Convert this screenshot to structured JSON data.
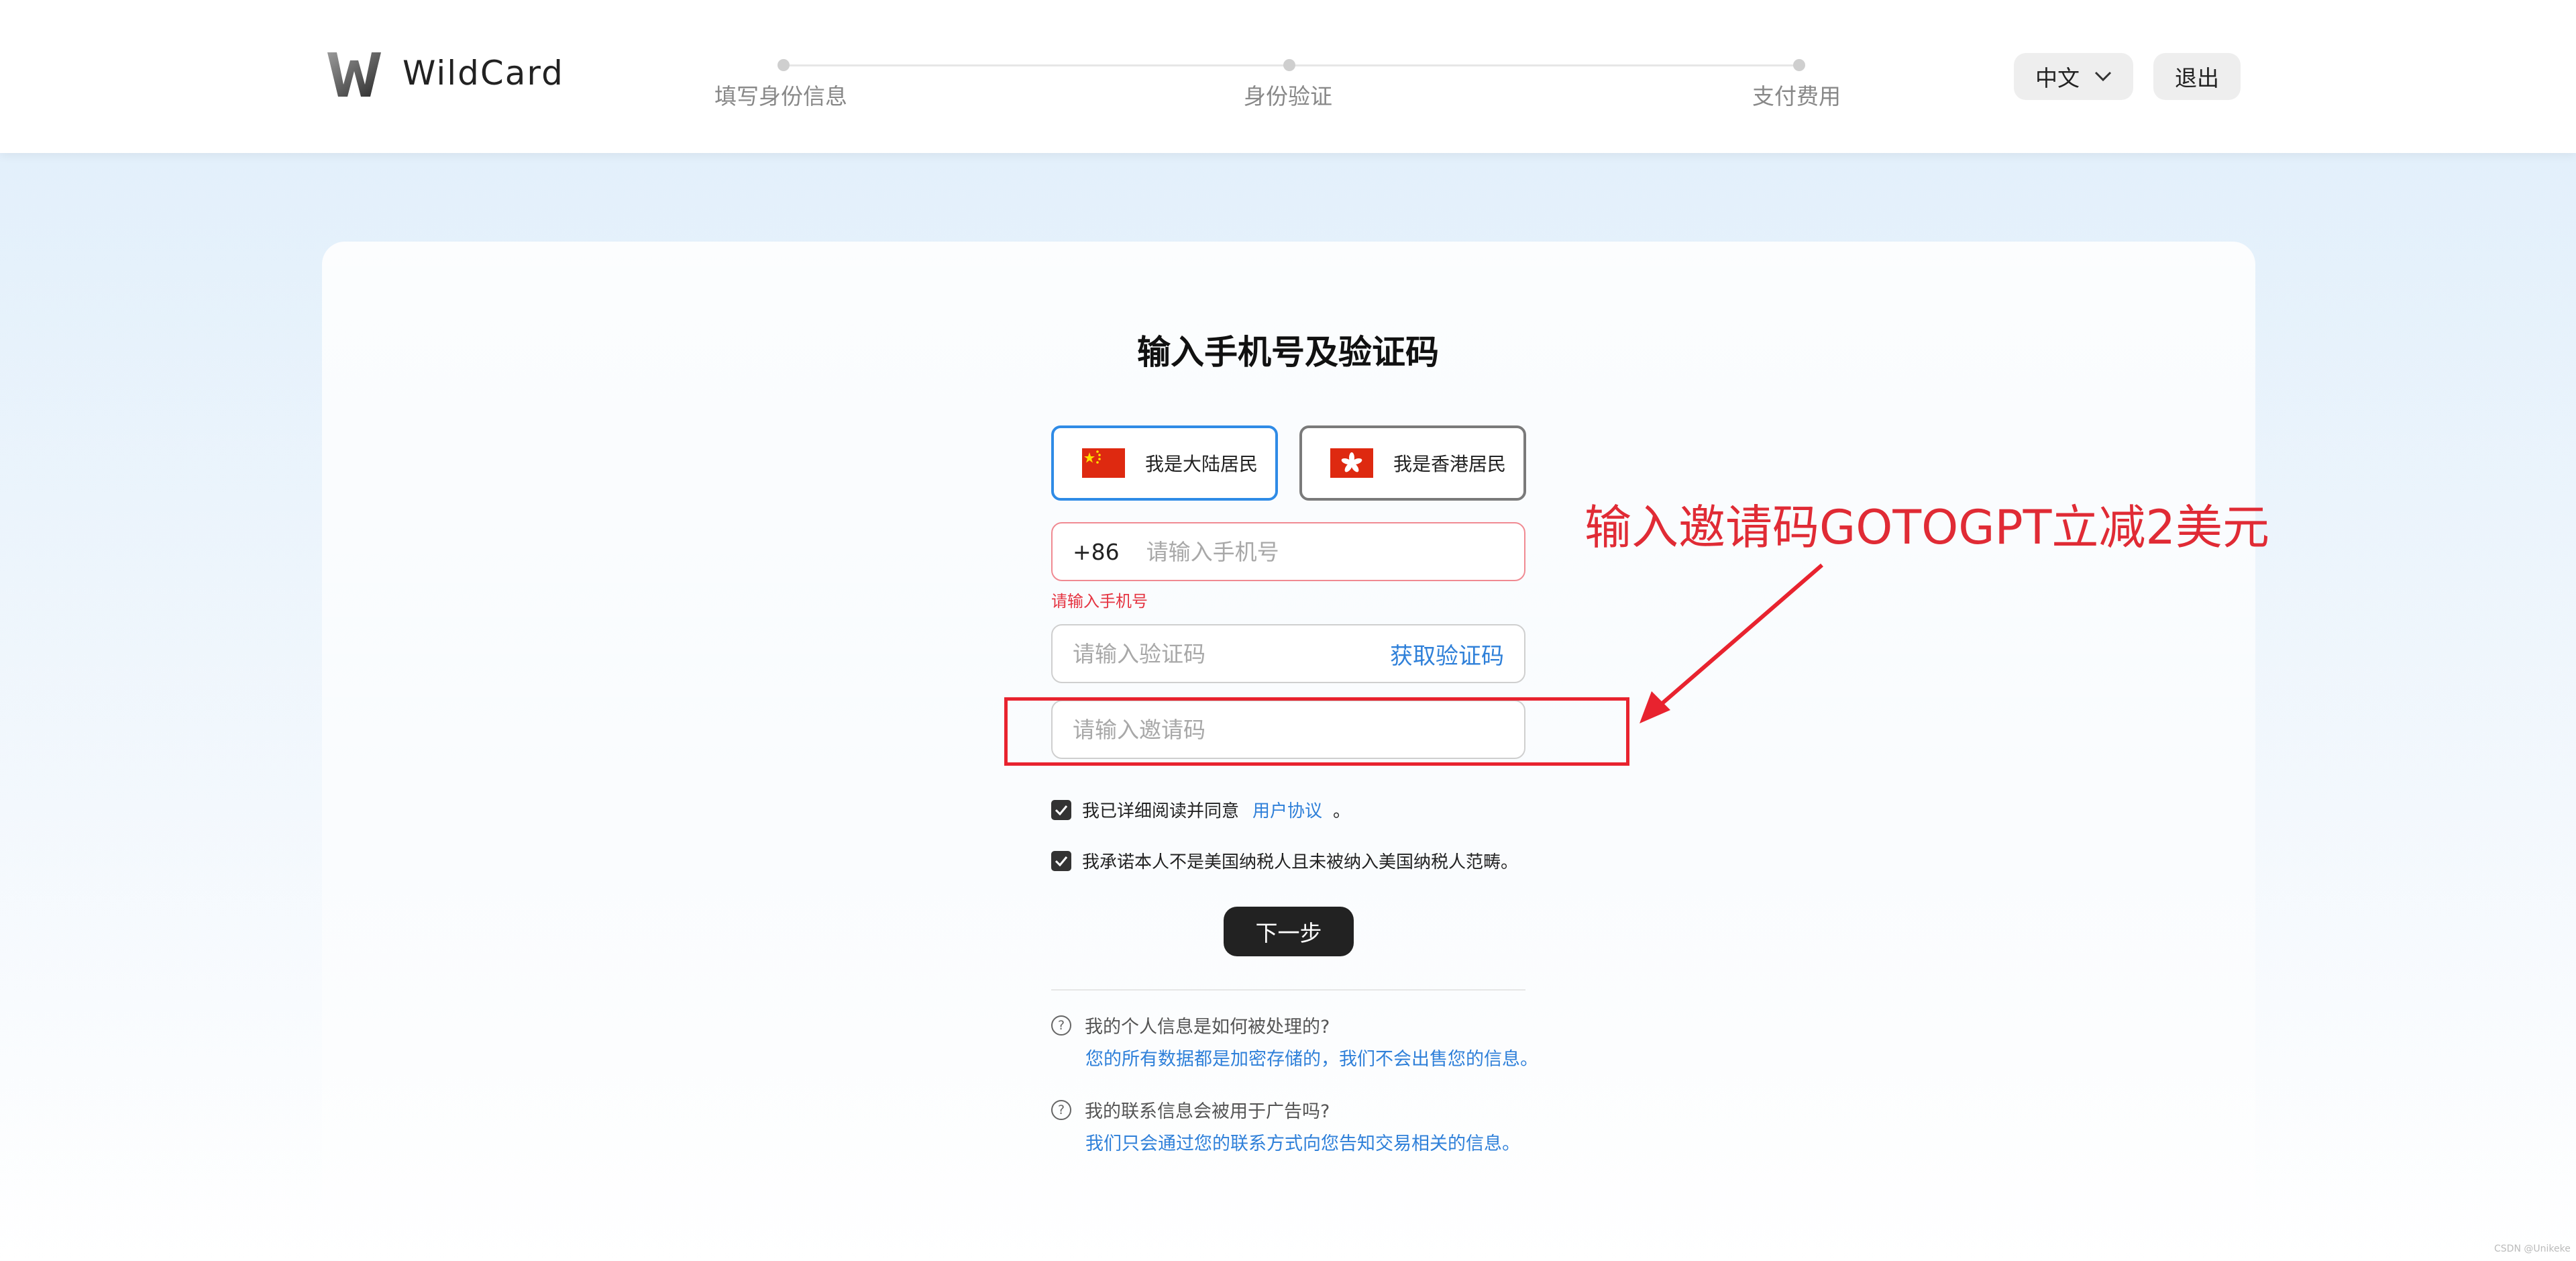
{
  "header": {
    "brand": "WildCard",
    "steps": [
      "填写身份信息",
      "身份验证",
      "支付费用"
    ],
    "language": "中文",
    "logout": "退出"
  },
  "form": {
    "title": "输入手机号及验证码",
    "residency": {
      "mainland": "我是大陆居民",
      "hongkong": "我是香港居民",
      "selected": "mainland"
    },
    "phone": {
      "prefix": "+86",
      "placeholder": "请输入手机号",
      "value": "",
      "error": "请输入手机号"
    },
    "code": {
      "placeholder": "请输入验证码",
      "get_code": "获取验证码"
    },
    "invite": {
      "placeholder": "请输入邀请码"
    },
    "agreement": {
      "text": "我已详细阅读并同意",
      "link": "用户协议",
      "suffix": "。",
      "checked": true
    },
    "tax": {
      "text": "我承诺本人不是美国纳税人且未被纳入美国纳税人范畴。",
      "checked": true
    },
    "next": "下一步"
  },
  "faq": [
    {
      "question": "我的个人信息是如何被处理的?",
      "answer": "您的所有数据都是加密存储的，我们不会出售您的信息。"
    },
    {
      "question": "我的联系信息会被用于广告吗?",
      "answer": "我们只会通过您的联系方式向您告知交易相关的信息。"
    }
  ],
  "annotation": {
    "text": "输入邀请码GOTOGPT立减2美元",
    "color": "#e02b35"
  },
  "watermark": "CSDN @Unikeke",
  "colors": {
    "accent": "#2f80d9",
    "error": "#e53441",
    "primary_button": "#222222"
  }
}
